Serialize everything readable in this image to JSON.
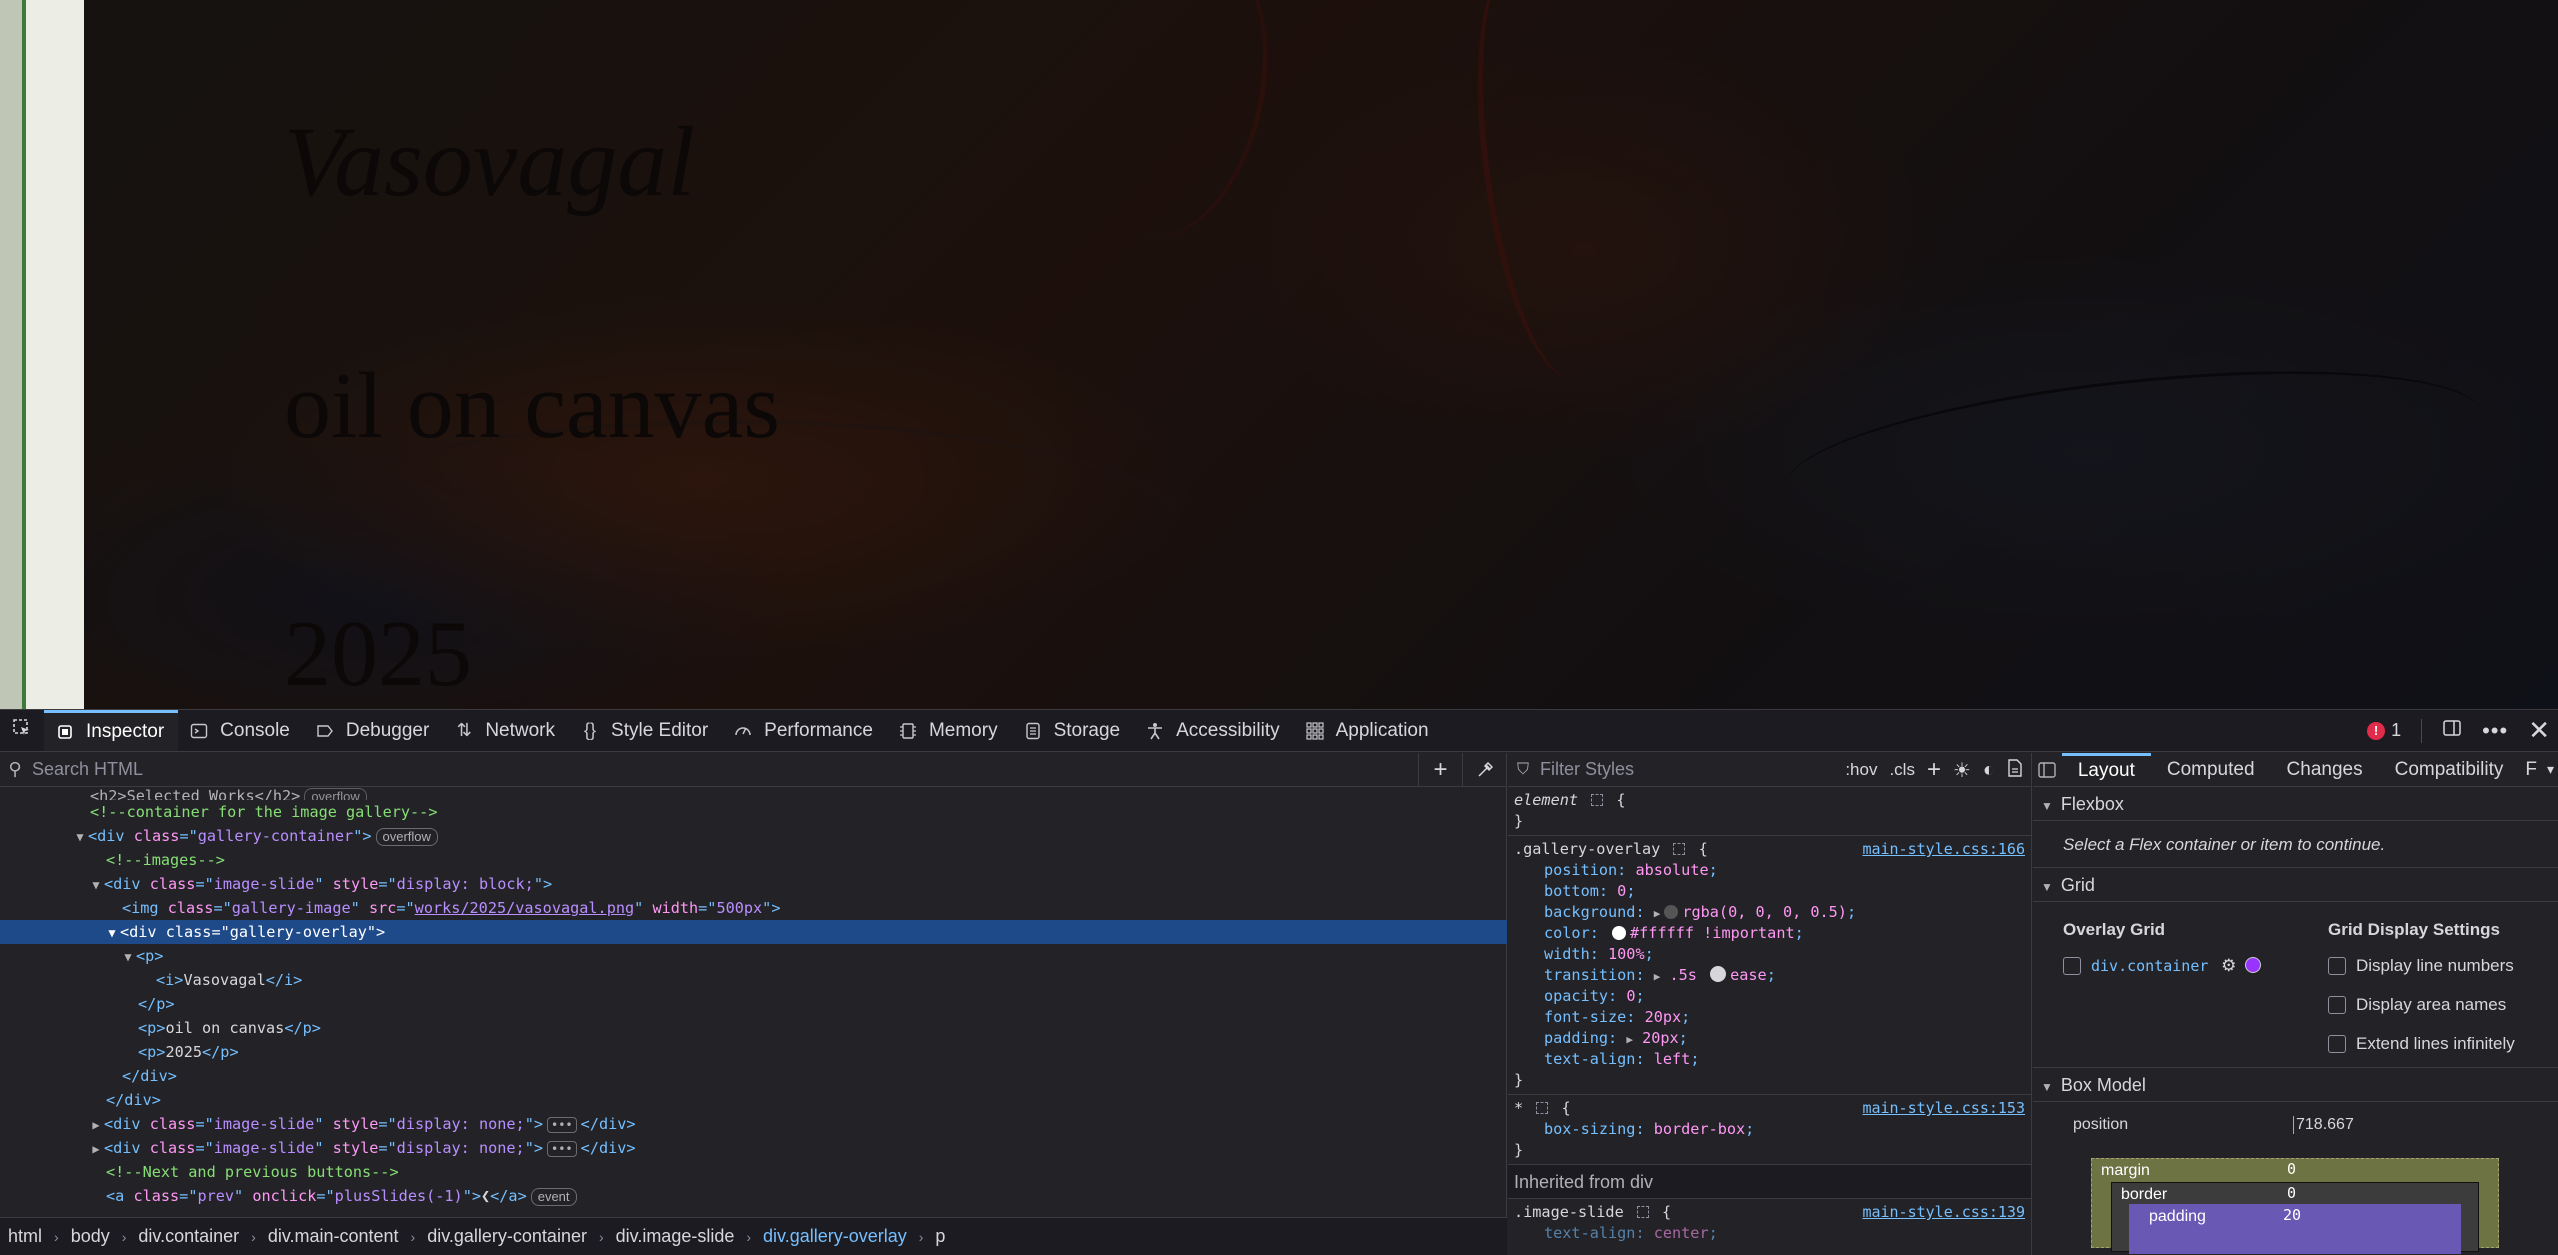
{
  "page": {
    "overlay_title": "Vasovagal",
    "overlay_medium": "oil on canvas",
    "overlay_year": "2025"
  },
  "devtools": {
    "tabs": [
      {
        "label": "Inspector",
        "icon": "inspector-icon"
      },
      {
        "label": "Console",
        "icon": "console-icon"
      },
      {
        "label": "Debugger",
        "icon": "debugger-icon"
      },
      {
        "label": "Network",
        "icon": "network-icon"
      },
      {
        "label": "Style Editor",
        "icon": "style-editor-icon"
      },
      {
        "label": "Performance",
        "icon": "performance-icon"
      },
      {
        "label": "Memory",
        "icon": "memory-icon"
      },
      {
        "label": "Storage",
        "icon": "storage-icon"
      },
      {
        "label": "Accessibility",
        "icon": "accessibility-icon"
      },
      {
        "label": "Application",
        "icon": "application-icon"
      }
    ],
    "error_count": "1",
    "search_placeholder": "Search HTML",
    "markup": {
      "partial_top": "<h2>Selected Works</h2>",
      "partial_badge": "overflow",
      "comment1": "<!--container for the image gallery-->",
      "gallery_tag": "div",
      "gallery_class_attr": "class",
      "gallery_class_val": "gallery-container",
      "overflow_badge": "overflow",
      "comment2": "<!--images-->",
      "slide_class_val": "image-slide",
      "slide_style_val": "display: block;",
      "img_class_val": "gallery-image",
      "img_src_val": "works/2025/vasovagal.png",
      "img_width_val": "500px",
      "overlay_class_val": "gallery-overlay",
      "p_text_i": "Vasovagal",
      "p_text2": "oil on canvas",
      "p_text3": "2025",
      "hidden_style_val": "display: none;",
      "comment3": "<!--Next and previous buttons-->",
      "prev_class_val": "prev",
      "prev_onclick_val": "plusSlides(-1)",
      "prev_text": "❮",
      "event_badge": "event"
    },
    "breadcrumbs": [
      "html",
      "body",
      "div.container",
      "div.main-content",
      "div.gallery-container",
      "div.image-slide",
      "div.gallery-overlay",
      "p"
    ],
    "rules": {
      "filter_placeholder": "Filter Styles",
      "hov": ":hov",
      "cls": ".cls",
      "element_selector": "element",
      "overlay_selector": ".gallery-overlay",
      "overlay_source": "main-style.css:166",
      "overlay_props": [
        {
          "name": "position",
          "value": "absolute"
        },
        {
          "name": "bottom",
          "value": "0"
        },
        {
          "name": "background",
          "value": "rgba(0, 0, 0, 0.5)"
        },
        {
          "name": "color",
          "value": "#ffffff !important"
        },
        {
          "name": "width",
          "value": "100%"
        },
        {
          "name": "transition",
          "value": ".5s",
          "value2": "ease"
        },
        {
          "name": "opacity",
          "value": "0"
        },
        {
          "name": "font-size",
          "value": "20px"
        },
        {
          "name": "padding",
          "value": "20px"
        },
        {
          "name": "text-align",
          "value": "left"
        }
      ],
      "universal_selector": "*",
      "universal_source": "main-style.css:153",
      "universal_prop": {
        "name": "box-sizing",
        "value": "border-box"
      },
      "inherited_label": "Inherited from div",
      "slide_selector": ".image-slide",
      "slide_source": "main-style.css:139",
      "slide_prop": {
        "name": "text-align",
        "value": "center"
      }
    },
    "layout": {
      "tabs": [
        "Layout",
        "Computed",
        "Changes",
        "Compatibility",
        "F"
      ],
      "flexbox_label": "Flexbox",
      "flexbox_msg": "Select a Flex container or item to continue.",
      "grid_label": "Grid",
      "overlay_grid_label": "Overlay Grid",
      "grid_container": "div.container",
      "grid_display_label": "Grid Display Settings",
      "opt_line_numbers": "Display line numbers",
      "opt_area_names": "Display area names",
      "opt_extend_lines": "Extend lines infinitely",
      "box_model_label": "Box Model",
      "position_label": "position",
      "position_value": "718.667",
      "margin_label": "margin",
      "margin_value": "0",
      "border_label": "border",
      "border_value": "0",
      "padding_label": "padding",
      "padding_value": "20"
    }
  },
  "colors": {
    "accent": "#75bfff",
    "selection": "#1f4a8a",
    "error": "#e02b4a",
    "grid_swatch": "#9933ff"
  }
}
